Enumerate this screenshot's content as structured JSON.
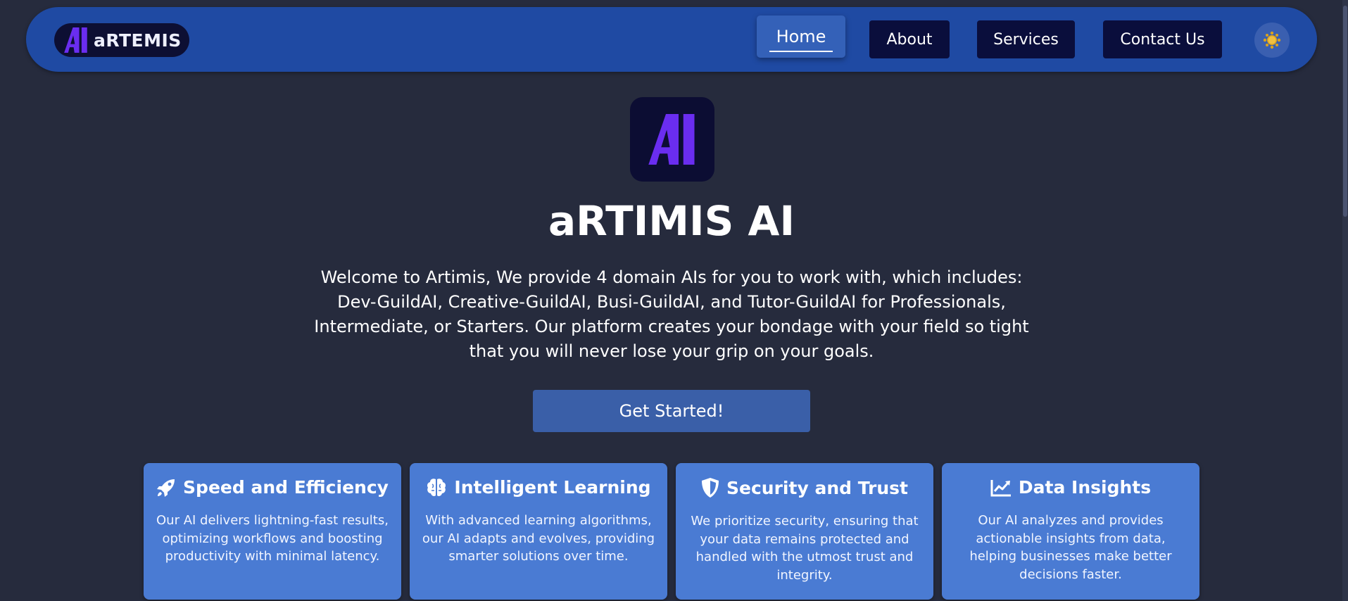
{
  "brand": {
    "name": "aRTEMIS",
    "logo_icon": "ai-logo-icon"
  },
  "nav": {
    "items": [
      {
        "label": "Home",
        "active": true
      },
      {
        "label": "About",
        "active": false
      },
      {
        "label": "Services",
        "active": false
      },
      {
        "label": "Contact Us",
        "active": false
      }
    ],
    "theme_toggle_icon": "sun-icon"
  },
  "hero": {
    "title": "aRTIMIS AI",
    "description": "Welcome to Artimis, We provide 4 domain AIs for you to work with, which includes: Dev-GuildAI, Creative-GuildAI, Busi-GuildAI, and Tutor-GuildAI for Professionals, Intermediate, or Starters. Our platform creates your bondage with your field so tight that you will never lose your grip on your goals.",
    "cta_label": "Get Started!"
  },
  "features": [
    {
      "icon": "rocket-icon",
      "title": "Speed and Efficiency",
      "text": "Our AI delivers lightning-fast results, optimizing workflows and boosting productivity with minimal latency."
    },
    {
      "icon": "brain-icon",
      "title": "Intelligent Learning",
      "text": "With advanced learning algorithms, our AI adapts and evolves, providing smarter solutions over time."
    },
    {
      "icon": "shield-icon",
      "title": "Security and Trust",
      "text": "We prioritize security, ensuring that your data remains protected and handled with the utmost trust and integrity."
    },
    {
      "icon": "chart-line-icon",
      "title": "Data Insights",
      "text": "Our AI analyzes and provides actionable insights from data, helping businesses make better decisions faster."
    }
  ],
  "colors": {
    "background": "#262b3d",
    "navbar": "#1f4aa3",
    "nav_button": "#0a0e3c",
    "card": "#4a7bd3",
    "logo_accent": "#6a2df0"
  }
}
